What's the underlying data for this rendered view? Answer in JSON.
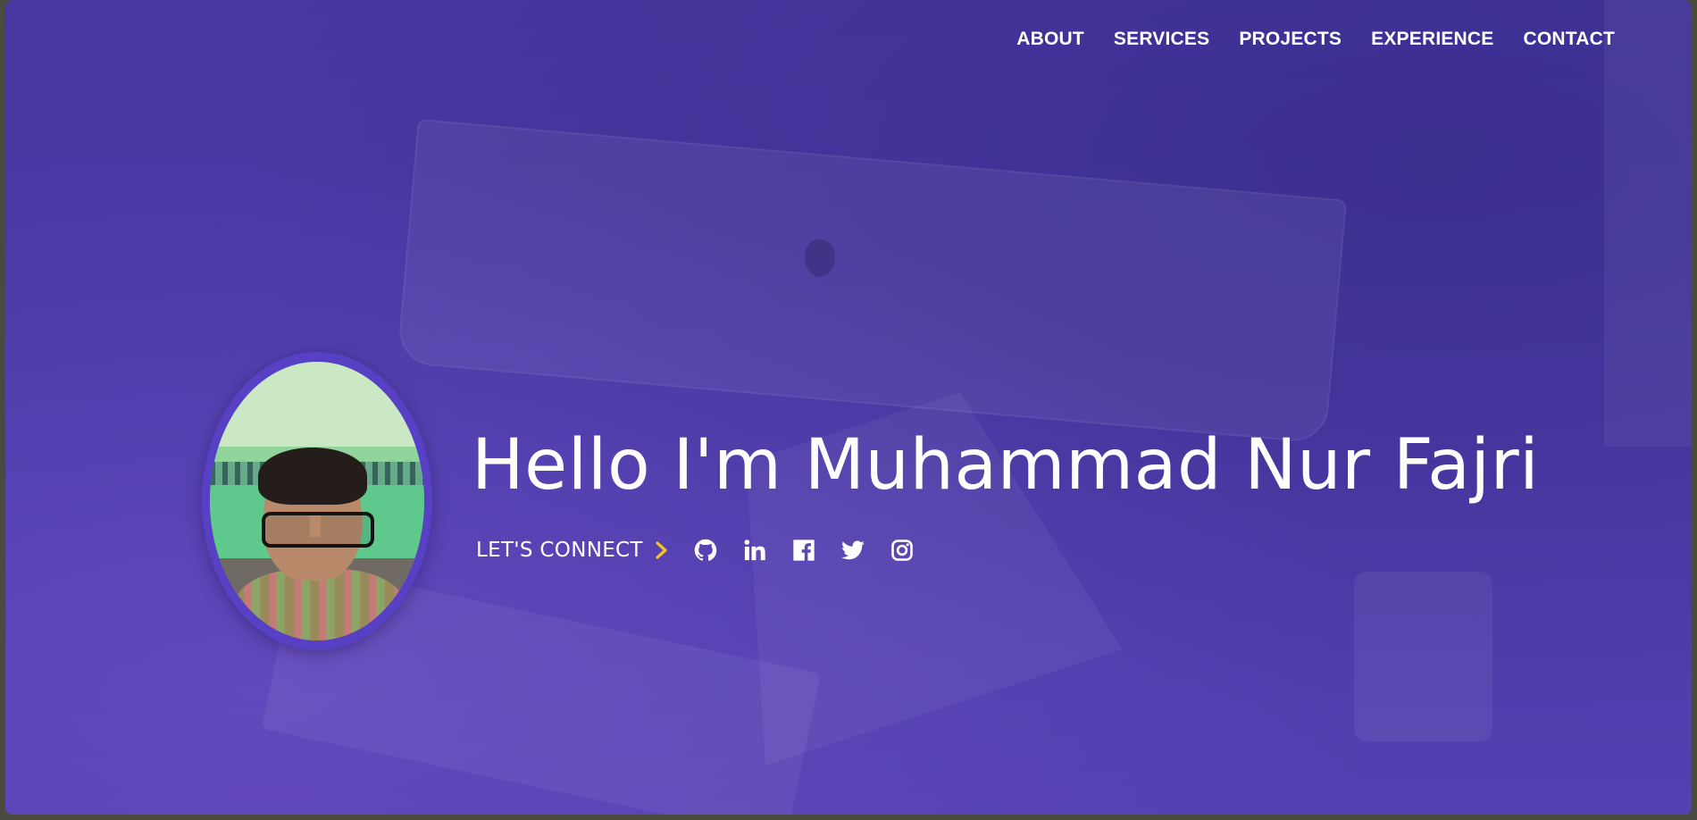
{
  "nav": {
    "items": [
      {
        "label": "ABOUT"
      },
      {
        "label": "SERVICES"
      },
      {
        "label": "PROJECTS"
      },
      {
        "label": "EXPERIENCE"
      },
      {
        "label": "CONTACT"
      }
    ]
  },
  "hero": {
    "headline": "Hello I'm Muhammad Nur Fajri",
    "connect_label": "LET'S CONNECT",
    "social": [
      {
        "icon": "github-icon"
      },
      {
        "icon": "linkedin-icon"
      },
      {
        "icon": "facebook-icon"
      },
      {
        "icon": "twitter-icon"
      },
      {
        "icon": "instagram-icon"
      }
    ]
  },
  "colors": {
    "background": "#4a3aa6",
    "text": "#ffffff",
    "accent_chevron": "#f5c518",
    "avatar_ring": "#5740c4"
  }
}
